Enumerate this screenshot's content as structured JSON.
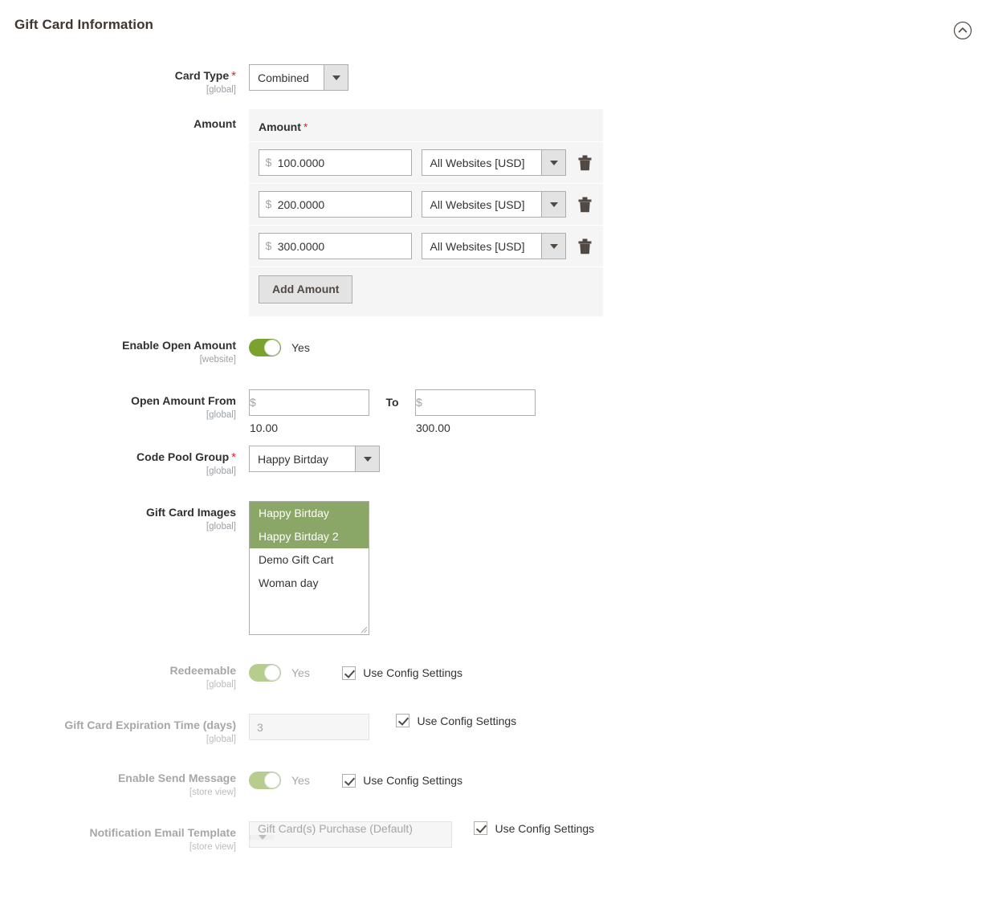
{
  "section": {
    "title": "Gift Card Information",
    "collapse_icon": "chevron-up-circle-icon",
    "collapsed": false
  },
  "colors": {
    "accent_green": "#79a22e",
    "accent_green_disabled": "#b6cd8e",
    "multiselect_highlight": "#8ba767",
    "required_star": "#e22626",
    "panel_bg": "#f5f5f5",
    "button_bg": "#e3e3e3",
    "title": "#41362f"
  },
  "fields": {
    "card_type": {
      "label": "Card Type",
      "required": true,
      "scope": "[global]",
      "value": "Combined"
    },
    "amount": {
      "label": "Amount",
      "panel_header": "Amount",
      "panel_header_required": true,
      "currency_symbol": "$",
      "rows": [
        {
          "value": "100.0000",
          "website": "All Websites [USD]",
          "delete_icon": "trash-icon"
        },
        {
          "value": "200.0000",
          "website": "All Websites [USD]",
          "delete_icon": "trash-icon"
        },
        {
          "value": "300.0000",
          "website": "All Websites [USD]",
          "delete_icon": "trash-icon"
        }
      ],
      "add_button": "Add Amount"
    },
    "enable_open_amount": {
      "label": "Enable Open Amount",
      "scope": "[website]",
      "toggle_state": "Yes",
      "enabled": true
    },
    "open_amount_from": {
      "label": "Open Amount From",
      "scope": "[global]",
      "currency_symbol": "$",
      "from_value": "10.00",
      "to_label": "To",
      "to_value": "300.00"
    },
    "code_pool_group": {
      "label": "Code Pool Group",
      "required": true,
      "scope": "[global]",
      "value": "Happy Birtday"
    },
    "gift_card_images": {
      "label": "Gift Card Images",
      "scope": "[global]",
      "options": [
        {
          "label": "Happy Birtday",
          "selected": true
        },
        {
          "label": "Happy Birtday 2",
          "selected": true
        },
        {
          "label": "Demo Gift Cart",
          "selected": false
        },
        {
          "label": "Woman day",
          "selected": false
        }
      ]
    },
    "redeemable": {
      "label": "Redeemable",
      "scope": "[global]",
      "toggle_state": "Yes",
      "enabled": false,
      "use_config_label": "Use Config Settings",
      "use_config_checked": true
    },
    "expiration_time": {
      "label": "Gift Card Expiration Time (days)",
      "scope": "[global]",
      "value": "3",
      "enabled": false,
      "use_config_label": "Use Config Settings",
      "use_config_checked": true
    },
    "enable_send_message": {
      "label": "Enable Send Message",
      "scope": "[store view]",
      "toggle_state": "Yes",
      "enabled": false,
      "use_config_label": "Use Config Settings",
      "use_config_checked": true
    },
    "notification_email_template": {
      "label": "Notification Email Template",
      "scope": "[store view]",
      "value": "Gift Card(s) Purchase (Default)",
      "enabled": false,
      "use_config_label": "Use Config Settings",
      "use_config_checked": true
    }
  }
}
